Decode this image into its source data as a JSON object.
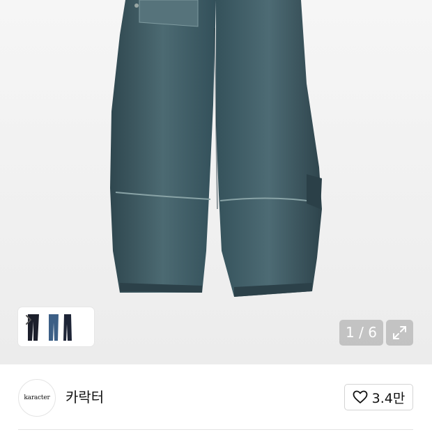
{
  "gallery": {
    "image_alt": "denim pants",
    "counter": "1 / 6",
    "thumbnails": [
      "black-pants",
      "blue-pants",
      "navy-pants"
    ],
    "expand_icon": "expand-icon",
    "next_icon": "chevron-right-icon"
  },
  "brand": {
    "logo_text": "karacter",
    "name": "카락터"
  },
  "like": {
    "icon": "heart-icon",
    "count": "3.4만"
  },
  "colors": {
    "denim": "#3f5a63",
    "denim_dark": "#2f454d",
    "gallery_bg": "#efefef",
    "border": "#d4d4d4"
  }
}
